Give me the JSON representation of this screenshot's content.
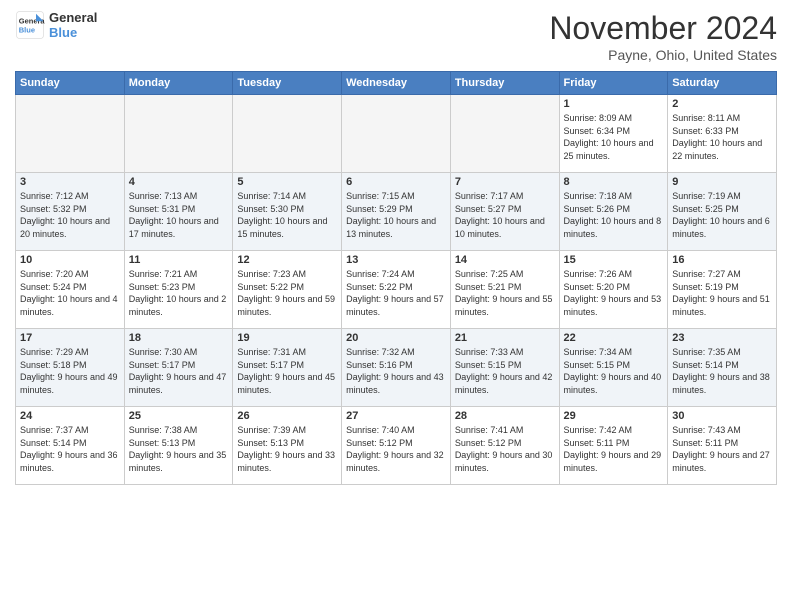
{
  "header": {
    "logo_line1": "General",
    "logo_line2": "Blue",
    "title": "November 2024",
    "subtitle": "Payne, Ohio, United States"
  },
  "days_of_week": [
    "Sunday",
    "Monday",
    "Tuesday",
    "Wednesday",
    "Thursday",
    "Friday",
    "Saturday"
  ],
  "weeks": [
    [
      {
        "day": "",
        "empty": true
      },
      {
        "day": "",
        "empty": true
      },
      {
        "day": "",
        "empty": true
      },
      {
        "day": "",
        "empty": true
      },
      {
        "day": "",
        "empty": true
      },
      {
        "day": "1",
        "sunrise": "Sunrise: 8:09 AM",
        "sunset": "Sunset: 6:34 PM",
        "daylight": "Daylight: 10 hours and 25 minutes."
      },
      {
        "day": "2",
        "sunrise": "Sunrise: 8:11 AM",
        "sunset": "Sunset: 6:33 PM",
        "daylight": "Daylight: 10 hours and 22 minutes."
      }
    ],
    [
      {
        "day": "3",
        "sunrise": "Sunrise: 7:12 AM",
        "sunset": "Sunset: 5:32 PM",
        "daylight": "Daylight: 10 hours and 20 minutes."
      },
      {
        "day": "4",
        "sunrise": "Sunrise: 7:13 AM",
        "sunset": "Sunset: 5:31 PM",
        "daylight": "Daylight: 10 hours and 17 minutes."
      },
      {
        "day": "5",
        "sunrise": "Sunrise: 7:14 AM",
        "sunset": "Sunset: 5:30 PM",
        "daylight": "Daylight: 10 hours and 15 minutes."
      },
      {
        "day": "6",
        "sunrise": "Sunrise: 7:15 AM",
        "sunset": "Sunset: 5:29 PM",
        "daylight": "Daylight: 10 hours and 13 minutes."
      },
      {
        "day": "7",
        "sunrise": "Sunrise: 7:17 AM",
        "sunset": "Sunset: 5:27 PM",
        "daylight": "Daylight: 10 hours and 10 minutes."
      },
      {
        "day": "8",
        "sunrise": "Sunrise: 7:18 AM",
        "sunset": "Sunset: 5:26 PM",
        "daylight": "Daylight: 10 hours and 8 minutes."
      },
      {
        "day": "9",
        "sunrise": "Sunrise: 7:19 AM",
        "sunset": "Sunset: 5:25 PM",
        "daylight": "Daylight: 10 hours and 6 minutes."
      }
    ],
    [
      {
        "day": "10",
        "sunrise": "Sunrise: 7:20 AM",
        "sunset": "Sunset: 5:24 PM",
        "daylight": "Daylight: 10 hours and 4 minutes."
      },
      {
        "day": "11",
        "sunrise": "Sunrise: 7:21 AM",
        "sunset": "Sunset: 5:23 PM",
        "daylight": "Daylight: 10 hours and 2 minutes."
      },
      {
        "day": "12",
        "sunrise": "Sunrise: 7:23 AM",
        "sunset": "Sunset: 5:22 PM",
        "daylight": "Daylight: 9 hours and 59 minutes."
      },
      {
        "day": "13",
        "sunrise": "Sunrise: 7:24 AM",
        "sunset": "Sunset: 5:22 PM",
        "daylight": "Daylight: 9 hours and 57 minutes."
      },
      {
        "day": "14",
        "sunrise": "Sunrise: 7:25 AM",
        "sunset": "Sunset: 5:21 PM",
        "daylight": "Daylight: 9 hours and 55 minutes."
      },
      {
        "day": "15",
        "sunrise": "Sunrise: 7:26 AM",
        "sunset": "Sunset: 5:20 PM",
        "daylight": "Daylight: 9 hours and 53 minutes."
      },
      {
        "day": "16",
        "sunrise": "Sunrise: 7:27 AM",
        "sunset": "Sunset: 5:19 PM",
        "daylight": "Daylight: 9 hours and 51 minutes."
      }
    ],
    [
      {
        "day": "17",
        "sunrise": "Sunrise: 7:29 AM",
        "sunset": "Sunset: 5:18 PM",
        "daylight": "Daylight: 9 hours and 49 minutes."
      },
      {
        "day": "18",
        "sunrise": "Sunrise: 7:30 AM",
        "sunset": "Sunset: 5:17 PM",
        "daylight": "Daylight: 9 hours and 47 minutes."
      },
      {
        "day": "19",
        "sunrise": "Sunrise: 7:31 AM",
        "sunset": "Sunset: 5:17 PM",
        "daylight": "Daylight: 9 hours and 45 minutes."
      },
      {
        "day": "20",
        "sunrise": "Sunrise: 7:32 AM",
        "sunset": "Sunset: 5:16 PM",
        "daylight": "Daylight: 9 hours and 43 minutes."
      },
      {
        "day": "21",
        "sunrise": "Sunrise: 7:33 AM",
        "sunset": "Sunset: 5:15 PM",
        "daylight": "Daylight: 9 hours and 42 minutes."
      },
      {
        "day": "22",
        "sunrise": "Sunrise: 7:34 AM",
        "sunset": "Sunset: 5:15 PM",
        "daylight": "Daylight: 9 hours and 40 minutes."
      },
      {
        "day": "23",
        "sunrise": "Sunrise: 7:35 AM",
        "sunset": "Sunset: 5:14 PM",
        "daylight": "Daylight: 9 hours and 38 minutes."
      }
    ],
    [
      {
        "day": "24",
        "sunrise": "Sunrise: 7:37 AM",
        "sunset": "Sunset: 5:14 PM",
        "daylight": "Daylight: 9 hours and 36 minutes."
      },
      {
        "day": "25",
        "sunrise": "Sunrise: 7:38 AM",
        "sunset": "Sunset: 5:13 PM",
        "daylight": "Daylight: 9 hours and 35 minutes."
      },
      {
        "day": "26",
        "sunrise": "Sunrise: 7:39 AM",
        "sunset": "Sunset: 5:13 PM",
        "daylight": "Daylight: 9 hours and 33 minutes."
      },
      {
        "day": "27",
        "sunrise": "Sunrise: 7:40 AM",
        "sunset": "Sunset: 5:12 PM",
        "daylight": "Daylight: 9 hours and 32 minutes."
      },
      {
        "day": "28",
        "sunrise": "Sunrise: 7:41 AM",
        "sunset": "Sunset: 5:12 PM",
        "daylight": "Daylight: 9 hours and 30 minutes."
      },
      {
        "day": "29",
        "sunrise": "Sunrise: 7:42 AM",
        "sunset": "Sunset: 5:11 PM",
        "daylight": "Daylight: 9 hours and 29 minutes."
      },
      {
        "day": "30",
        "sunrise": "Sunrise: 7:43 AM",
        "sunset": "Sunset: 5:11 PM",
        "daylight": "Daylight: 9 hours and 27 minutes."
      }
    ]
  ]
}
